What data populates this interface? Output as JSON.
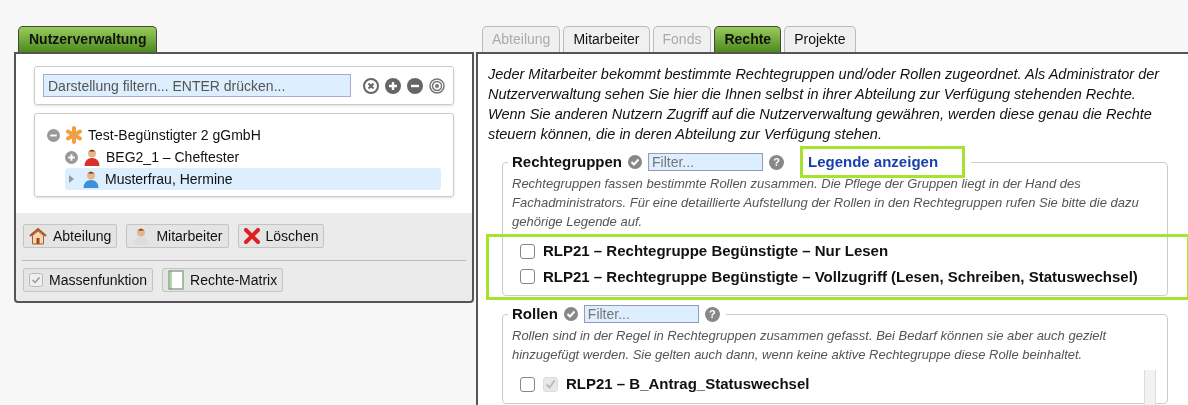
{
  "left": {
    "tab": {
      "label": "Nutzerverwaltung",
      "selected": true
    },
    "filter": {
      "placeholder": "Darstellung filtern... ENTER drücken..."
    },
    "tree": [
      {
        "label": "Test-Begünstigter 2 gGmbH",
        "kind": "org",
        "expanded": true,
        "selected": false,
        "children": [
          {
            "label": "BEG2_1 – Cheftester",
            "kind": "head",
            "expanded": false,
            "selected": false
          },
          {
            "label": "Musterfrau, Hermine",
            "kind": "staff",
            "expanded": false,
            "selected": true
          }
        ]
      }
    ],
    "button_rows": [
      [
        {
          "label": "Abteilung",
          "kind": "house"
        },
        {
          "label": "Mitarbeiter",
          "kind": "person"
        },
        {
          "label": "Löschen",
          "kind": "delete"
        }
      ],
      [
        {
          "label": "Massenfunktion",
          "kind": "check"
        },
        {
          "label": "Rechte-Matrix",
          "kind": "notebook"
        }
      ]
    ]
  },
  "right": {
    "tabs": [
      {
        "label": "Abteilung",
        "selected": false,
        "disabled": true
      },
      {
        "label": "Mitarbeiter",
        "selected": false,
        "disabled": false
      },
      {
        "label": "Fonds",
        "selected": false,
        "disabled": true
      },
      {
        "label": "Rechte",
        "selected": true,
        "disabled": false
      },
      {
        "label": "Projekte",
        "selected": false,
        "disabled": false
      }
    ],
    "intro": "Jeder Mitarbeiter bekommt bestimmte Rechtegruppen und/oder Rollen zugeordnet. Als Administrator der Nutzerverwaltung sehen Sie hier die Ihnen selbst in ihrer Abteilung zur Verfügung stehenden Rechte. Wenn Sie anderen Nutzern Zugriff auf die Nutzerverwaltung gewähren, werden diese genau die Rechte steuern können, die in deren Abteilung zur Verfügung stehen.",
    "sections": [
      {
        "title": "Rechtegruppen",
        "filter_placeholder": "Filter...",
        "help_icon": "?",
        "link": "Legende anzeigen",
        "description": "Rechtegruppen fassen bestimmte Rollen zusammen. Die Pflege der Gruppen liegt in der Hand des Fachadministrators. Für eine detaillierte Aufstellung der Rollen in den Rechtegruppen rufen Sie bitte die dazu gehörige Legende auf.",
        "items": [
          {
            "label": "RLP21 – Rechtegruppe Begünstigte – Nur Lesen",
            "checked": false
          },
          {
            "label": "RLP21 – Rechtegruppe Begünstigte – Vollzugriff (Lesen, Schreiben, Statuswechsel)",
            "checked": false
          }
        ]
      },
      {
        "title": "Rollen",
        "filter_placeholder": "Filter...",
        "help_icon": "?",
        "description": "Rollen sind in der Regel in Rechtegruppen zusammen gefasst. Bei Bedarf können sie aber auch gezielt hinzugefügt werden. Sie gelten auch dann, wenn keine aktive Rechtegruppe diese Rolle beinhaltet.",
        "items": [
          {
            "label": "RLP21 – B_Antrag_Statuswechsel",
            "checked": false,
            "group_checked": true
          }
        ]
      }
    ]
  }
}
